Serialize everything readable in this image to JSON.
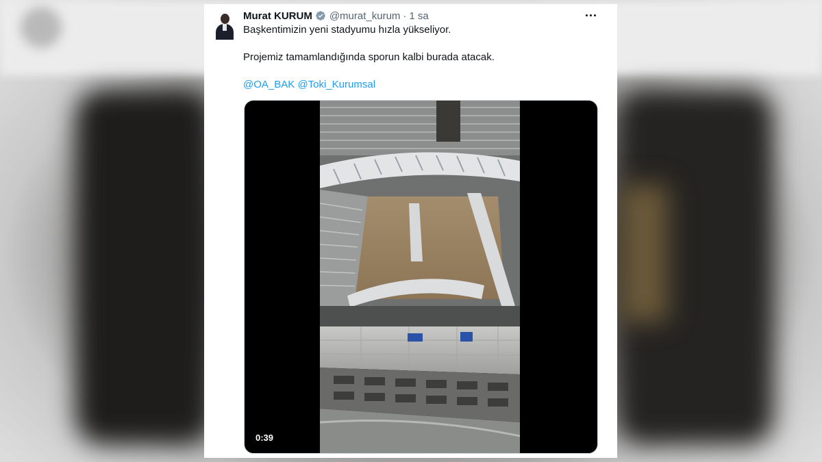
{
  "tweet": {
    "author_name": "Murat KURUM",
    "handle": "@murat_kurum",
    "separator": "·",
    "time": "1 sa",
    "text_line1": "Başkentimizin yeni stadyumu hızla yükseliyor.",
    "text_line2": "Projemiz tamamlandığında sporun kalbi burada atacak.",
    "mentions": [
      "@OA_BAK",
      "@Toki_Kurumsal"
    ]
  },
  "video": {
    "duration": "0:39"
  },
  "icons": {
    "verified": "verified-badge-icon",
    "more": "more-options-icon"
  },
  "colors": {
    "link": "#1d9bf0",
    "text": "#0f1419",
    "secondary": "#536471",
    "verified": "#829aab"
  }
}
